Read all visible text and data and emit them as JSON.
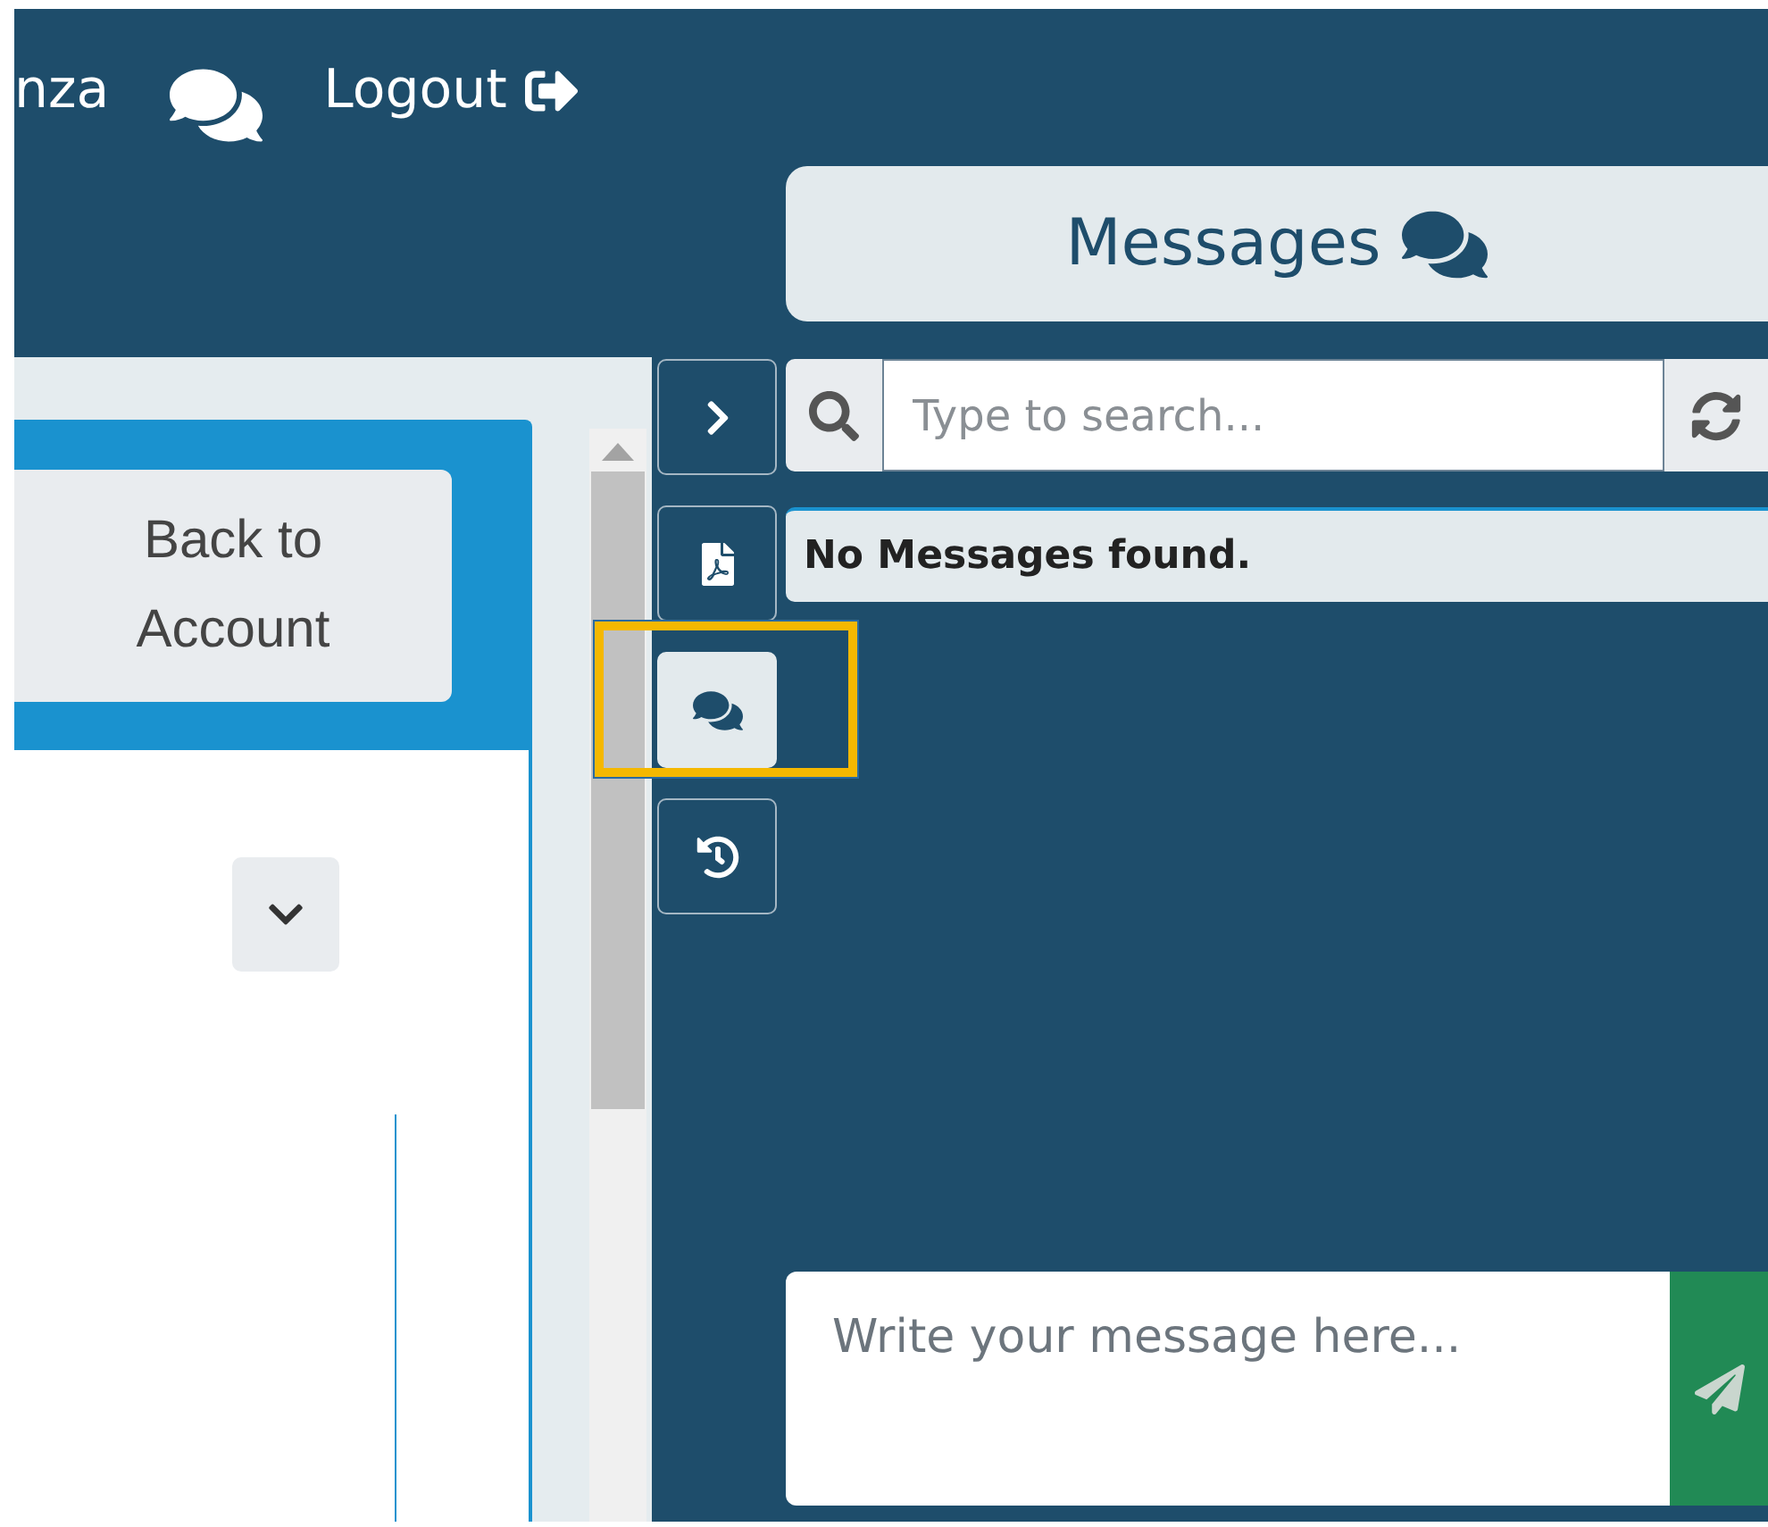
{
  "top_nav": {
    "user_name": "nza",
    "logout": "Logout"
  },
  "account_panel": {
    "back_button": "Back to Account"
  },
  "side_tabs": [
    {
      "kind": "collapse",
      "selected": false
    },
    {
      "kind": "pdf",
      "selected": false
    },
    {
      "kind": "messages",
      "selected": true
    },
    {
      "kind": "history",
      "selected": false
    }
  ],
  "messages": {
    "title": "Messages",
    "search": {
      "placeholder": "Type to search..."
    },
    "empty_text": "No Messages found.",
    "composer": {
      "placeholder": "Write your message here..."
    }
  }
}
